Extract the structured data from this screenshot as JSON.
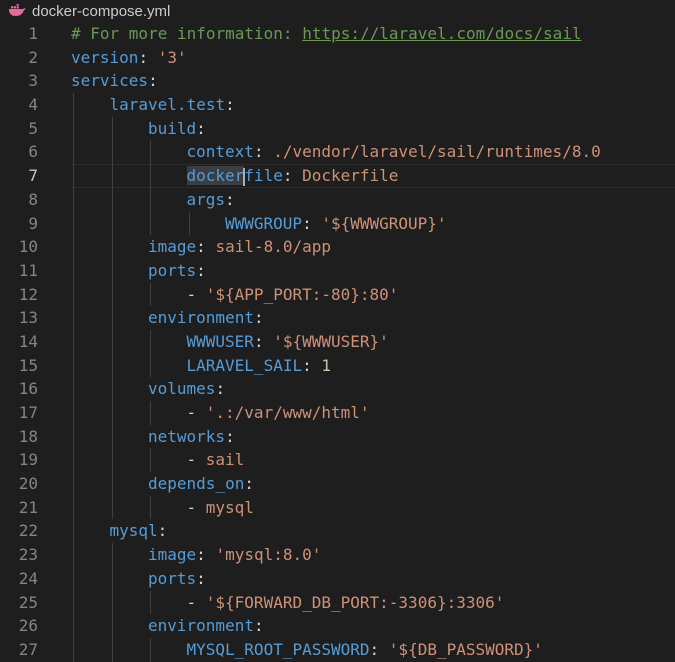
{
  "tab": {
    "filename": "docker-compose.yml",
    "icon": "docker-whale-icon"
  },
  "editor": {
    "current_line": 7,
    "lines": [
      {
        "n": "1",
        "indent": 0,
        "parts": [
          {
            "t": "# For more information: ",
            "c": "comment"
          },
          {
            "t": "https://laravel.com/docs/sail",
            "c": "link"
          }
        ]
      },
      {
        "n": "2",
        "indent": 0,
        "parts": [
          {
            "t": "version",
            "c": "key"
          },
          {
            "t": ": ",
            "c": "punc"
          },
          {
            "t": "'3'",
            "c": "str"
          }
        ]
      },
      {
        "n": "3",
        "indent": 0,
        "parts": [
          {
            "t": "services",
            "c": "key"
          },
          {
            "t": ":",
            "c": "punc"
          }
        ]
      },
      {
        "n": "4",
        "indent": 1,
        "parts": [
          {
            "t": "laravel.test",
            "c": "key"
          },
          {
            "t": ":",
            "c": "punc"
          }
        ]
      },
      {
        "n": "5",
        "indent": 2,
        "parts": [
          {
            "t": "build",
            "c": "key"
          },
          {
            "t": ":",
            "c": "punc"
          }
        ]
      },
      {
        "n": "6",
        "indent": 3,
        "parts": [
          {
            "t": "context",
            "c": "key"
          },
          {
            "t": ": ",
            "c": "punc"
          },
          {
            "t": "./vendor/laravel/sail/runtimes/8.0",
            "c": "str"
          }
        ]
      },
      {
        "n": "7",
        "indent": 3,
        "parts": [
          {
            "t": "docker",
            "c": "key",
            "sel": true
          },
          {
            "t": "",
            "c": "cursor"
          },
          {
            "t": "file",
            "c": "key"
          },
          {
            "t": ": ",
            "c": "punc"
          },
          {
            "t": "Dockerfile",
            "c": "str"
          }
        ]
      },
      {
        "n": "8",
        "indent": 3,
        "parts": [
          {
            "t": "args",
            "c": "key"
          },
          {
            "t": ":",
            "c": "punc"
          }
        ]
      },
      {
        "n": "9",
        "indent": 4,
        "parts": [
          {
            "t": "WWWGROUP",
            "c": "key"
          },
          {
            "t": ": ",
            "c": "punc"
          },
          {
            "t": "'${WWWGROUP}'",
            "c": "str"
          }
        ]
      },
      {
        "n": "10",
        "indent": 2,
        "parts": [
          {
            "t": "image",
            "c": "key"
          },
          {
            "t": ": ",
            "c": "punc"
          },
          {
            "t": "sail-8.0/app",
            "c": "str"
          }
        ]
      },
      {
        "n": "11",
        "indent": 2,
        "parts": [
          {
            "t": "ports",
            "c": "key"
          },
          {
            "t": ":",
            "c": "punc"
          }
        ]
      },
      {
        "n": "12",
        "indent": 3,
        "parts": [
          {
            "t": "- ",
            "c": "punc"
          },
          {
            "t": "'${APP_PORT:-80}:80'",
            "c": "str"
          }
        ]
      },
      {
        "n": "13",
        "indent": 2,
        "parts": [
          {
            "t": "environment",
            "c": "key"
          },
          {
            "t": ":",
            "c": "punc"
          }
        ]
      },
      {
        "n": "14",
        "indent": 3,
        "parts": [
          {
            "t": "WWWUSER",
            "c": "key"
          },
          {
            "t": ": ",
            "c": "punc"
          },
          {
            "t": "'${WWWUSER}'",
            "c": "str"
          }
        ]
      },
      {
        "n": "15",
        "indent": 3,
        "parts": [
          {
            "t": "LARAVEL_SAIL",
            "c": "key"
          },
          {
            "t": ": ",
            "c": "punc"
          },
          {
            "t": "1",
            "c": "num"
          }
        ]
      },
      {
        "n": "16",
        "indent": 2,
        "parts": [
          {
            "t": "volumes",
            "c": "key"
          },
          {
            "t": ":",
            "c": "punc"
          }
        ]
      },
      {
        "n": "17",
        "indent": 3,
        "parts": [
          {
            "t": "- ",
            "c": "punc"
          },
          {
            "t": "'.:/var/www/html'",
            "c": "str"
          }
        ]
      },
      {
        "n": "18",
        "indent": 2,
        "parts": [
          {
            "t": "networks",
            "c": "key"
          },
          {
            "t": ":",
            "c": "punc"
          }
        ]
      },
      {
        "n": "19",
        "indent": 3,
        "parts": [
          {
            "t": "- ",
            "c": "punc"
          },
          {
            "t": "sail",
            "c": "str"
          }
        ]
      },
      {
        "n": "20",
        "indent": 2,
        "parts": [
          {
            "t": "depends_on",
            "c": "key"
          },
          {
            "t": ":",
            "c": "punc"
          }
        ]
      },
      {
        "n": "21",
        "indent": 3,
        "parts": [
          {
            "t": "- ",
            "c": "punc"
          },
          {
            "t": "mysql",
            "c": "str"
          }
        ]
      },
      {
        "n": "22",
        "indent": 1,
        "parts": [
          {
            "t": "mysql",
            "c": "key"
          },
          {
            "t": ":",
            "c": "punc"
          }
        ]
      },
      {
        "n": "23",
        "indent": 2,
        "parts": [
          {
            "t": "image",
            "c": "key"
          },
          {
            "t": ": ",
            "c": "punc"
          },
          {
            "t": "'mysql:8.0'",
            "c": "str"
          }
        ]
      },
      {
        "n": "24",
        "indent": 2,
        "parts": [
          {
            "t": "ports",
            "c": "key"
          },
          {
            "t": ":",
            "c": "punc"
          }
        ]
      },
      {
        "n": "25",
        "indent": 3,
        "parts": [
          {
            "t": "- ",
            "c": "punc"
          },
          {
            "t": "'${FORWARD_DB_PORT:-3306}:3306'",
            "c": "str"
          }
        ]
      },
      {
        "n": "26",
        "indent": 2,
        "parts": [
          {
            "t": "environment",
            "c": "key"
          },
          {
            "t": ":",
            "c": "punc"
          }
        ]
      },
      {
        "n": "27",
        "indent": 3,
        "parts": [
          {
            "t": "MYSQL_ROOT_PASSWORD",
            "c": "key"
          },
          {
            "t": ": ",
            "c": "punc"
          },
          {
            "t": "'${DB_PASSWORD}'",
            "c": "str"
          }
        ]
      }
    ]
  },
  "colors": {
    "background": "#1e1e1e",
    "line_number": "#858585",
    "comment": "#6a9955",
    "key": "#569cd6",
    "string": "#ce9178",
    "number": "#b5cea8"
  }
}
